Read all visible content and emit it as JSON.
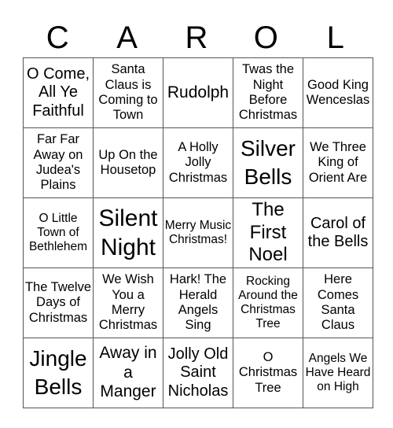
{
  "header": {
    "letters": [
      "C",
      "A",
      "R",
      "O",
      "L"
    ]
  },
  "board": {
    "rows": [
      [
        "O Come, All Ye Faithful",
        "Santa Claus is Coming to Town",
        "Rudolph",
        "Twas the Night Before Christmas",
        "Good King Wenceslas"
      ],
      [
        "Far Far Away on Judea's Plains",
        "Up On the Housetop",
        "A Holly Jolly Christmas",
        "Silver Bells",
        "We Three King of Orient Are"
      ],
      [
        "O Little Town of Bethlehem",
        "Silent Night",
        "Merry Music Christmas!",
        "The First Noel",
        "Carol of the Bells"
      ],
      [
        "The Twelve Days of Christmas",
        "We Wish You a Merry Christmas",
        "Hark! The Herald Angels Sing",
        "Rocking Around the Christmas Tree",
        "Here Comes Santa Claus"
      ],
      [
        "Jingle Bells",
        "Away in a Manger",
        "Jolly Old Saint Nicholas",
        "O Christmas Tree",
        "Angels We Have Heard on High"
      ]
    ]
  },
  "colors": {
    "border": "#555555",
    "text": "#000000",
    "background": "#ffffff"
  }
}
